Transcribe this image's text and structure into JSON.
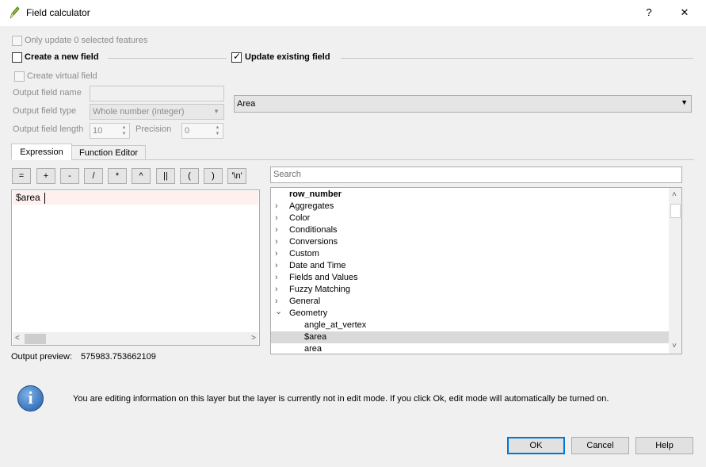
{
  "window": {
    "title": "Field calculator",
    "help_glyph": "?",
    "close_glyph": "✕"
  },
  "options": {
    "only_update_selected": "Only update 0 selected features",
    "create_new_field": "Create a new field",
    "update_existing_field": "Update existing field",
    "create_virtual_field": "Create virtual field",
    "output_field_name_label": "Output field name",
    "output_field_name_value": "",
    "output_field_type_label": "Output field type",
    "output_field_type_value": "Whole number (integer)",
    "output_field_length_label": "Output field length",
    "output_field_length_value": "10",
    "precision_label": "Precision",
    "precision_value": "0",
    "existing_field_value": "Area"
  },
  "tabs": [
    "Expression",
    "Function Editor"
  ],
  "operators": [
    "=",
    "+",
    "-",
    "/",
    "*",
    "^",
    "||",
    "(",
    ")",
    "'\\n'"
  ],
  "expression": {
    "text": "$area",
    "output_preview_label": "Output preview:",
    "output_preview_value": "575983.753662109"
  },
  "function_list": {
    "search_placeholder": "Search",
    "items": [
      {
        "label": "row_number",
        "bold": true,
        "chevron": ""
      },
      {
        "label": "Aggregates",
        "chevron": "›"
      },
      {
        "label": "Color",
        "chevron": "›"
      },
      {
        "label": "Conditionals",
        "chevron": "›"
      },
      {
        "label": "Conversions",
        "chevron": "›"
      },
      {
        "label": "Custom",
        "chevron": "›"
      },
      {
        "label": "Date and Time",
        "chevron": "›"
      },
      {
        "label": "Fields and Values",
        "chevron": "›"
      },
      {
        "label": "Fuzzy Matching",
        "chevron": "›"
      },
      {
        "label": "General",
        "chevron": "›"
      },
      {
        "label": "Geometry",
        "chevron": "⌄",
        "expanded": true
      },
      {
        "label": "angle_at_vertex",
        "child": true
      },
      {
        "label": "$area",
        "child": true,
        "selected": true
      },
      {
        "label": "area",
        "child": true
      }
    ]
  },
  "message": "You are editing information on this layer but the layer is currently not in edit mode. If you click Ok, edit mode will automatically be turned on.",
  "buttons": {
    "ok": "OK",
    "cancel": "Cancel",
    "help": "Help"
  },
  "colors": {
    "selection": "#d9d9d9",
    "default_button_border": "#0078d7"
  }
}
